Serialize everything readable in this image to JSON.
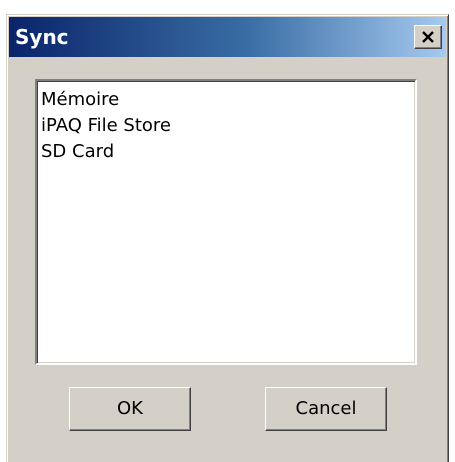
{
  "dialog": {
    "title": "Sync",
    "close_icon": "close-icon"
  },
  "listbox": {
    "items": [
      {
        "label": "Mémoire"
      },
      {
        "label": "iPAQ File Store"
      },
      {
        "label": "SD Card"
      }
    ]
  },
  "buttons": {
    "ok_label": "OK",
    "cancel_label": "Cancel"
  },
  "colors": {
    "title_gradient_start": "#0a246a",
    "title_gradient_end": "#a6caf0",
    "face": "#d4d0c8"
  }
}
